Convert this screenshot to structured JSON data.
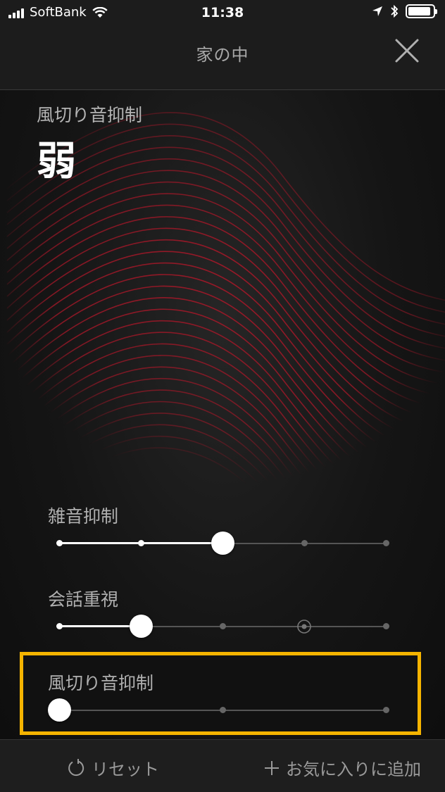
{
  "status_bar": {
    "carrier": "SoftBank",
    "time": "11:38",
    "battery_level": 0.9
  },
  "nav": {
    "title": "家の中"
  },
  "mode": {
    "label": "風切り音抑制",
    "value": "弱"
  },
  "sliders": [
    {
      "label": "雑音抑制",
      "stops": 5,
      "value_index": 2
    },
    {
      "label": "会話重視",
      "stops": 5,
      "value_index": 1,
      "marker_index": 3
    },
    {
      "label": "風切り音抑制",
      "stops": 3,
      "value_index": 0
    }
  ],
  "bottom": {
    "reset_label": "リセット",
    "fav_label": "お気に入りに追加"
  },
  "colors": {
    "highlight": "#f5b400",
    "wave": "#a01828"
  }
}
